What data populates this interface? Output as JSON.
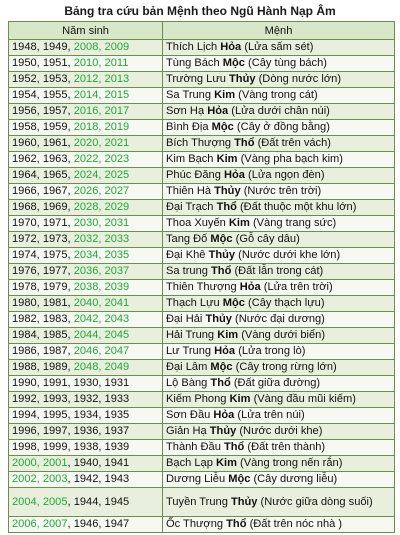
{
  "title": "Bảng tra cứu bản Mệnh theo Ngũ Hành Nạp Âm",
  "columns": [
    "Năm sinh",
    "Mệnh"
  ],
  "rows": [
    {
      "y1": "1948, 1949, ",
      "y2": "2008, 2009",
      "y3": "",
      "m1": "Thích Lịch ",
      "el": "Hỏa",
      "m2": " (Lửa sấm sét)"
    },
    {
      "y1": "1950, 1951, ",
      "y2": "2010, 2011",
      "y3": "",
      "m1": "Tùng Bách ",
      "el": "Mộc",
      "m2": " (Cây tùng bách)"
    },
    {
      "y1": "1952, 1953, ",
      "y2": "2012, 2013",
      "y3": "",
      "m1": "Trường Lưu ",
      "el": "Thủy",
      "m2": " (Dòng nước lớn)"
    },
    {
      "y1": "1954, 1955, ",
      "y2": "2014, 2015",
      "y3": "",
      "m1": "Sa Trung ",
      "el": "Kim",
      "m2": " (Vàng trong cát)"
    },
    {
      "y1": "1956, 1957, ",
      "y2": "2016, 2017",
      "y3": "",
      "m1": "Sơn Hạ ",
      "el": "Hỏa",
      "m2": " (Lửa dưới chân núi)"
    },
    {
      "y1": "1958, 1959, ",
      "y2": "2018, 2019",
      "y3": "",
      "m1": "Bình Địa ",
      "el": "Mộc",
      "m2": " (Cây ở đồng bằng)"
    },
    {
      "y1": "1960, 1961, ",
      "y2": "2020, 2021",
      "y3": "",
      "m1": "Bích Thượng ",
      "el": "Thổ",
      "m2": " (Đất trên vách)"
    },
    {
      "y1": "1962, 1963, ",
      "y2": "2022, 2023",
      "y3": "",
      "m1": "Kim Bạch ",
      "el": "Kim",
      "m2": " (Vàng pha bạch kim)"
    },
    {
      "y1": "1964, 1965, ",
      "y2": "2024, 2025",
      "y3": "",
      "m1": "Phúc Đăng ",
      "el": "Hỏa",
      "m2": " (Lửa ngọn đèn)"
    },
    {
      "y1": "1966, 1967, ",
      "y2": "2026, 2027",
      "y3": "",
      "m1": "Thiên Hà ",
      "el": "Thủy",
      "m2": " (Nước trên trời)"
    },
    {
      "y1": "1968, 1969, ",
      "y2": "2028, 2029",
      "y3": "",
      "m1": "Đại Trạch ",
      "el": "Thổ",
      "m2": " (Đất thuộc một khu lớn)"
    },
    {
      "y1": "1970, 1971, ",
      "y2": "2030, 2031",
      "y3": "",
      "m1": "Thoa Xuyến ",
      "el": "Kim",
      "m2": " (Vàng trang sức)"
    },
    {
      "y1": "1972, 1973, ",
      "y2": "2032, 2033",
      "y3": "",
      "m1": "Tang Đố ",
      "el": "Mộc",
      "m2": " (Gỗ cây dâu)"
    },
    {
      "y1": "1974, 1975, ",
      "y2": "2034, 2035",
      "y3": "",
      "m1": "Đại Khê ",
      "el": "Thủy",
      "m2": " (Nước dưới khe lớn)"
    },
    {
      "y1": "1976, 1977, ",
      "y2": "2036, 2037",
      "y3": "",
      "m1": "Sa trung ",
      "el": "Thổ",
      "m2": " (Đất lẫn trong cát)"
    },
    {
      "y1": "1978, 1979, ",
      "y2": "2038, 2039",
      "y3": "",
      "m1": "Thiên Thượng ",
      "el": "Hỏa",
      "m2": " (Lửa trên trời)"
    },
    {
      "y1": "1980, 1981, ",
      "y2": "2040, 2041",
      "y3": "",
      "m1": "Thạch Lựu ",
      "el": "Mộc",
      "m2": " (Cây thạch lựu)"
    },
    {
      "y1": "1982, 1983, ",
      "y2": "2042, 2043",
      "y3": "",
      "m1": "Đại Hải ",
      "el": "Thủy",
      "m2": " (Nước đại dương)"
    },
    {
      "y1": "1984, 1985, ",
      "y2": "2044, 2045",
      "y3": "",
      "m1": "Hải Trung ",
      "el": "Kim",
      "m2": " (Vàng dưới biển)"
    },
    {
      "y1": "1986, 1987, ",
      "y2": "2046, 2047",
      "y3": "",
      "m1": "Lư Trung ",
      "el": "Hỏa",
      "m2": " (Lửa trong lò)"
    },
    {
      "y1": "1988, 1989, ",
      "y2": "2048, 2049",
      "y3": "",
      "m1": "Đại Lâm ",
      "el": "Mộc",
      "m2": " (Cây trong rừng lớn)"
    },
    {
      "y1": "1990, 1991, 1930, 1931",
      "y2": "",
      "y3": "",
      "m1": "Lộ Bàng ",
      "el": "Thổ",
      "m2": " (Đất giữa đường)"
    },
    {
      "y1": "1992, 1993, 1932, 1933",
      "y2": "",
      "y3": "",
      "m1": "Kiếm Phong ",
      "el": "Kim",
      "m2": " (Vàng đầu mũi kiếm)"
    },
    {
      "y1": "1994, 1995, 1934, 1935",
      "y2": "",
      "y3": "",
      "m1": "Sơn Đầu ",
      "el": "Hỏa",
      "m2": " (Lửa trên núi)"
    },
    {
      "y1": "1996, 1997, 1936, 1937",
      "y2": "",
      "y3": "",
      "m1": "Giản Hạ ",
      "el": "Thủy",
      "m2": " (Nước dưới khe)"
    },
    {
      "y1": "1998, 1999, 1938, 1939",
      "y2": "",
      "y3": "",
      "m1": "Thành Đầu ",
      "el": "Thổ",
      "m2": " (Đất trên thành)"
    },
    {
      "y1": "",
      "y2": "2000, 2001",
      "y3": ", 1940, 1941",
      "m1": "Bạch Lạp ",
      "el": "Kim",
      "m2": " (Vàng trong nến rắn)"
    },
    {
      "y1": "",
      "y2": "2002, 2003",
      "y3": ", 1942, 1943",
      "m1": "Dương Liễu ",
      "el": "Mộc",
      "m2": " (Cây dương liễu)"
    },
    {
      "y1": "",
      "y2": "2004, 2005",
      "y3": ", 1944, 1945",
      "m1": "Tuyền Trung ",
      "el": "Thủy",
      "m2": " (Nước giữa dòng suối)",
      "tall": true
    },
    {
      "y1": "",
      "y2": "2006, 2007",
      "y3": ", 1946, 1947",
      "m1": "Ốc Thượng ",
      "el": "Thổ",
      "m2": " (Đất trên nóc nhà )"
    }
  ]
}
